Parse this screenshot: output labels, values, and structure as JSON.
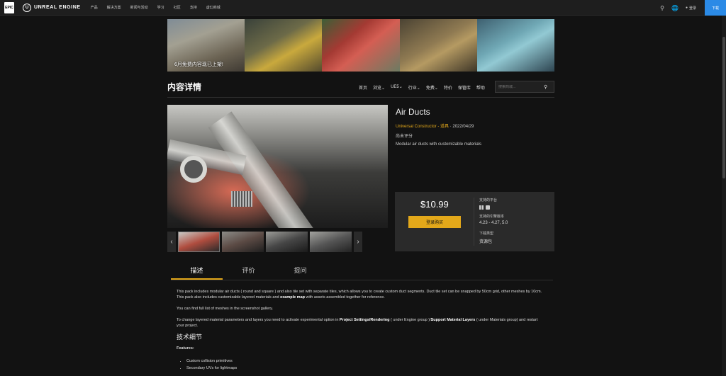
{
  "topnav": {
    "epic_logo": "EPIC",
    "brand": "UNREAL ENGINE",
    "links": [
      "产品",
      "解决方案",
      "新闻与活动",
      "学习",
      "社区",
      "支持",
      "虚幻商城"
    ],
    "login": "登录",
    "download": "下载"
  },
  "banner": {
    "text": "6月免费内容现已上架!"
  },
  "subnav": {
    "title": "内容详情",
    "links": [
      "首页",
      "浏览",
      "UE5",
      "行业",
      "免费",
      "特价",
      "保管库",
      "帮助"
    ],
    "search_placeholder": "搜索商城..."
  },
  "product": {
    "title": "Air Ducts",
    "seller": "Universal Constructor - 道具",
    "date": " · 2022/04/29",
    "rating": "尚未评分",
    "description": "Modular air ducts with customizable materials",
    "price": "$10.99",
    "buy_button": "登录购买",
    "platforms_label": "支持的平台",
    "engine_label": "支持的引擎版本",
    "engine_versions": "4.23 - 4.27, 5.0",
    "download_type_label": "下载类型",
    "download_type": "资源包"
  },
  "tabs": [
    "描述",
    "评价",
    "提问"
  ],
  "content": {
    "p1_a": "This pack includes modular air ducts ( round and square ) and also tile set with separate tiles, which allows you to create custom duct segments. Duct tile set can be snapped by 50cm grid, other meshes by 10cm. This pack also includes customizable layered materials and ",
    "p1_b": "example map",
    "p1_c": " with assets assembled together for reference.",
    "p2": "You can find full list of meshes in the screenshot gallery.",
    "p3_a": "To change layered material parameters and layers you need to activate experimental option in ",
    "p3_b": "Project Settings/Rendering",
    "p3_c": " ( under Engine group )/",
    "p3_d": "Support Material Layers",
    "p3_e": " ( under Materials group) and restart your project.",
    "tech_title": "技术细节",
    "features_title": "Features:",
    "features": [
      "Custom collision primitives",
      "Secondary UVs for lightmaps"
    ]
  }
}
